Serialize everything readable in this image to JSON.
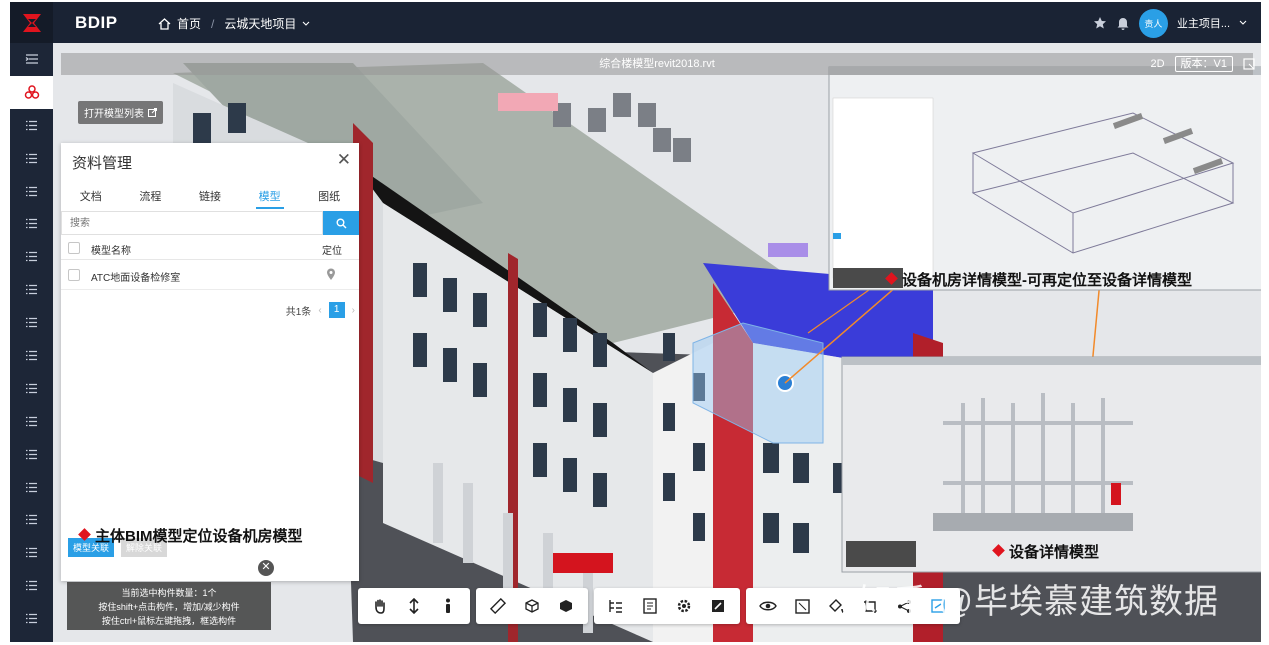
{
  "header": {
    "brand": "BDIP",
    "breadcrumb_home": "首页",
    "breadcrumb_sep": "/",
    "breadcrumb_project": "云城天地项目",
    "user_avatar": "责人",
    "user_name": "业主项目..."
  },
  "viewer": {
    "model_title": "综合楼模型revit2018.rvt",
    "view_mode": "2D",
    "version_label": "版本：V1",
    "open_list_label": "打开模型列表"
  },
  "doc_panel": {
    "title": "资料管理",
    "tabs": [
      "文档",
      "流程",
      "链接",
      "模型",
      "图纸"
    ],
    "active_tab": "模型",
    "search_placeholder": "搜索",
    "col_name": "模型名称",
    "col_locate": "定位",
    "rows": [
      {
        "name": "ATC地面设备检修室"
      }
    ],
    "total": "共1条",
    "page": "1",
    "btn_link": "模型关联",
    "btn_unlink": "解除关联"
  },
  "selection": {
    "line1": "当前选中构件数量：1个",
    "line2": "按住shift+点击构件，增加/减少构件",
    "line3": "按住ctrl+鼠标左键拖拽，框选构件"
  },
  "annotations": {
    "main": "主体BIM模型定位设备机房模型",
    "room": "设备机房详情模型-可再定位至设备详情模型",
    "detail": "设备详情模型"
  },
  "watermark": "知乎 @毕埃慕建筑数据",
  "colors": {
    "accent": "#2a9fe6",
    "topbar": "#1a2334",
    "sidebar": "#1d2637",
    "marker": "#e0141e"
  }
}
